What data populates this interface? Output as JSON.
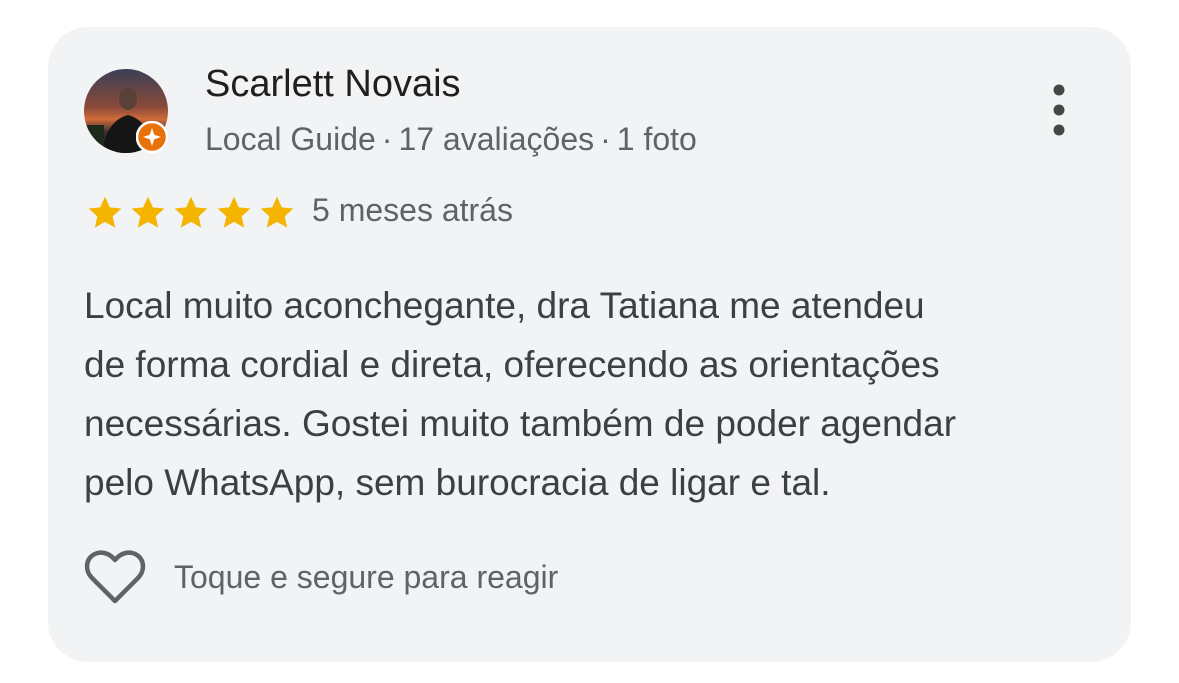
{
  "review": {
    "author_name": "Scarlett Novais",
    "author_badge": "Local Guide",
    "review_count": "17 avaliações",
    "photo_count": "1 foto",
    "meta_separator": "·",
    "rating": 5,
    "rating_max": 5,
    "time_ago": "5 meses atrás",
    "text_lines": [
      "Local muito aconchegante, dra Tatiana me atendeu",
      "de forma cordial e direta, oferecendo as orientações",
      "necessárias. Gostei muito também de poder agendar",
      "pelo WhatsApp, sem burocracia de ligar e tal."
    ],
    "react_label": "Toque e segure para reagir"
  },
  "icons": {
    "avatar": "avatar-photo",
    "badge": "local-guide-badge-icon",
    "more": "more-vert-icon",
    "star": "star-icon",
    "react": "heart-outline-icon"
  },
  "colors": {
    "card_background": "#f2f3f5",
    "star": "#f4b400",
    "badge": "#e8710a",
    "primary_text": "#1f1f1f",
    "secondary_text": "#5f6368",
    "body_text": "#3c4043"
  }
}
